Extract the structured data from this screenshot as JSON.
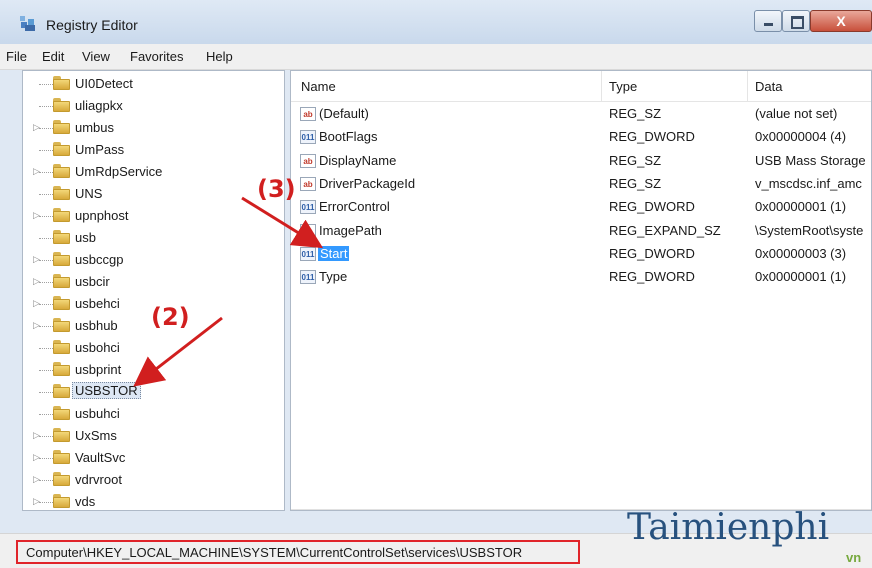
{
  "window": {
    "title": "Registry Editor",
    "close_label": "X"
  },
  "menu": [
    "File",
    "Edit",
    "View",
    "Favorites",
    "Help"
  ],
  "tree": {
    "items": [
      {
        "label": "UI0Detect",
        "expandable": false
      },
      {
        "label": "uliagpkx",
        "expandable": false
      },
      {
        "label": "umbus",
        "expandable": true
      },
      {
        "label": "UmPass",
        "expandable": false
      },
      {
        "label": "UmRdpService",
        "expandable": true
      },
      {
        "label": "UNS",
        "expandable": false
      },
      {
        "label": "upnphost",
        "expandable": true
      },
      {
        "label": "usb",
        "expandable": false
      },
      {
        "label": "usbccgp",
        "expandable": true
      },
      {
        "label": "usbcir",
        "expandable": true
      },
      {
        "label": "usbehci",
        "expandable": true
      },
      {
        "label": "usbhub",
        "expandable": true
      },
      {
        "label": "usbohci",
        "expandable": false
      },
      {
        "label": "usbprint",
        "expandable": false
      },
      {
        "label": "USBSTOR",
        "expandable": false,
        "selected": true
      },
      {
        "label": "usbuhci",
        "expandable": false
      },
      {
        "label": "UxSms",
        "expandable": true
      },
      {
        "label": "VaultSvc",
        "expandable": true
      },
      {
        "label": "vdrvroot",
        "expandable": true
      },
      {
        "label": "vds",
        "expandable": true
      }
    ],
    "scroll_thumb_label": "III"
  },
  "values": {
    "columns": [
      "Name",
      "Type",
      "Data"
    ],
    "rows": [
      {
        "icon": "ab",
        "name": "(Default)",
        "type": "REG_SZ",
        "data": "(value not set)"
      },
      {
        "icon": "dword",
        "name": "BootFlags",
        "type": "REG_DWORD",
        "data": "0x00000004 (4)"
      },
      {
        "icon": "ab",
        "name": "DisplayName",
        "type": "REG_SZ",
        "data": "USB Mass Storage"
      },
      {
        "icon": "ab",
        "name": "DriverPackageId",
        "type": "REG_SZ",
        "data": "v_mscdsc.inf_amc"
      },
      {
        "icon": "dword",
        "name": "ErrorControl",
        "type": "REG_DWORD",
        "data": "0x00000001 (1)"
      },
      {
        "icon": "ab",
        "name": "ImagePath",
        "type": "REG_EXPAND_SZ",
        "data": "\\SystemRoot\\syste"
      },
      {
        "icon": "dword",
        "name": "Start",
        "type": "REG_DWORD",
        "data": "0x00000003 (3)",
        "selected": true
      },
      {
        "icon": "dword",
        "name": "Type",
        "type": "REG_DWORD",
        "data": "0x00000001 (1)"
      }
    ],
    "icon_labels": {
      "ab": "ab",
      "dword": "011"
    }
  },
  "status": {
    "path": "Computer\\HKEY_LOCAL_MACHINE\\SYSTEM\\CurrentControlSet\\services\\USBSTOR"
  },
  "annotations": {
    "step2": "(2)",
    "step3": "(3)"
  },
  "watermark": {
    "text": "Taimienphi",
    "sub": "vn"
  },
  "colors": {
    "highlight": "#3399ff",
    "annotation": "#d11f1f",
    "status_box": "#e0242a"
  }
}
